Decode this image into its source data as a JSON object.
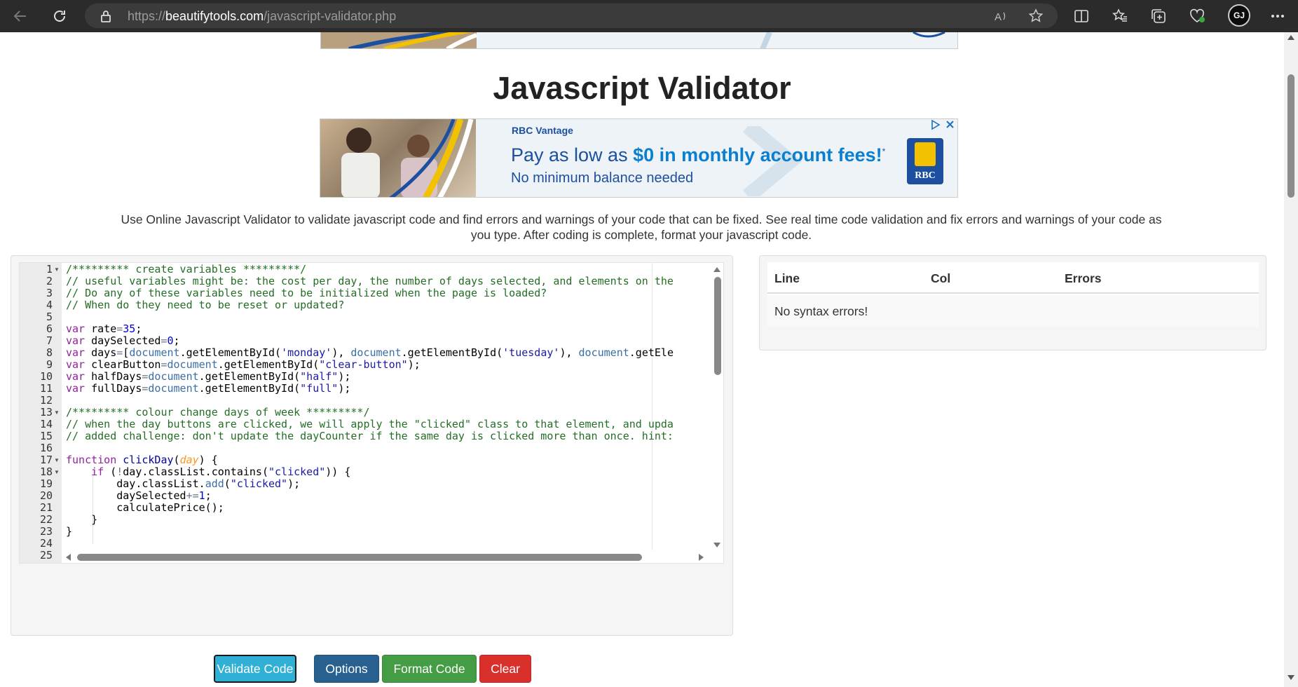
{
  "browser": {
    "url_scheme": "https://",
    "url_host": "beautifytools.com",
    "url_path": "/javascript-validator.php",
    "avatar_initials": "GJ"
  },
  "page": {
    "title": "Javascript Validator",
    "intro": "Use Online Javascript Validator to validate javascript code and find errors and warnings of your code that can be fixed. See real time code validation and fix errors and warnings of your code as you type. After coding is complete, format your javascript code."
  },
  "ad": {
    "brand": "RBC Vantage",
    "headline_pre": "Pay as low as ",
    "headline_hl": "$0 in monthly account fees!",
    "headline_mark": "*",
    "sub": "No minimum balance needed",
    "logo_text": "RBC"
  },
  "editor": {
    "line_numbers": [
      "1",
      "2",
      "3",
      "4",
      "5",
      "6",
      "7",
      "8",
      "9",
      "10",
      "11",
      "12",
      "13",
      "14",
      "15",
      "16",
      "17",
      "18",
      "19",
      "20",
      "21",
      "22",
      "23",
      "24",
      "25"
    ],
    "fold_lines": [
      1,
      13,
      17,
      18
    ]
  },
  "buttons": {
    "validate": "Validate Code",
    "options": "Options",
    "format": "Format Code",
    "clear": "Clear"
  },
  "results": {
    "col_line": "Line",
    "col_col": "Col",
    "col_errors": "Errors",
    "message": "No syntax errors!"
  },
  "colors": {
    "validate": "#31b0d5",
    "options": "#286090",
    "format": "#449d44",
    "clear": "#d9302c",
    "comment": "#236e24",
    "keyword": "#93219f"
  },
  "icons": [
    "back-icon",
    "refresh-icon",
    "lock-icon",
    "read-aloud-icon",
    "favorite-star-icon",
    "split-screen-icon",
    "favorites-icon",
    "collections-icon",
    "browser-essentials-icon",
    "more-icon"
  ]
}
